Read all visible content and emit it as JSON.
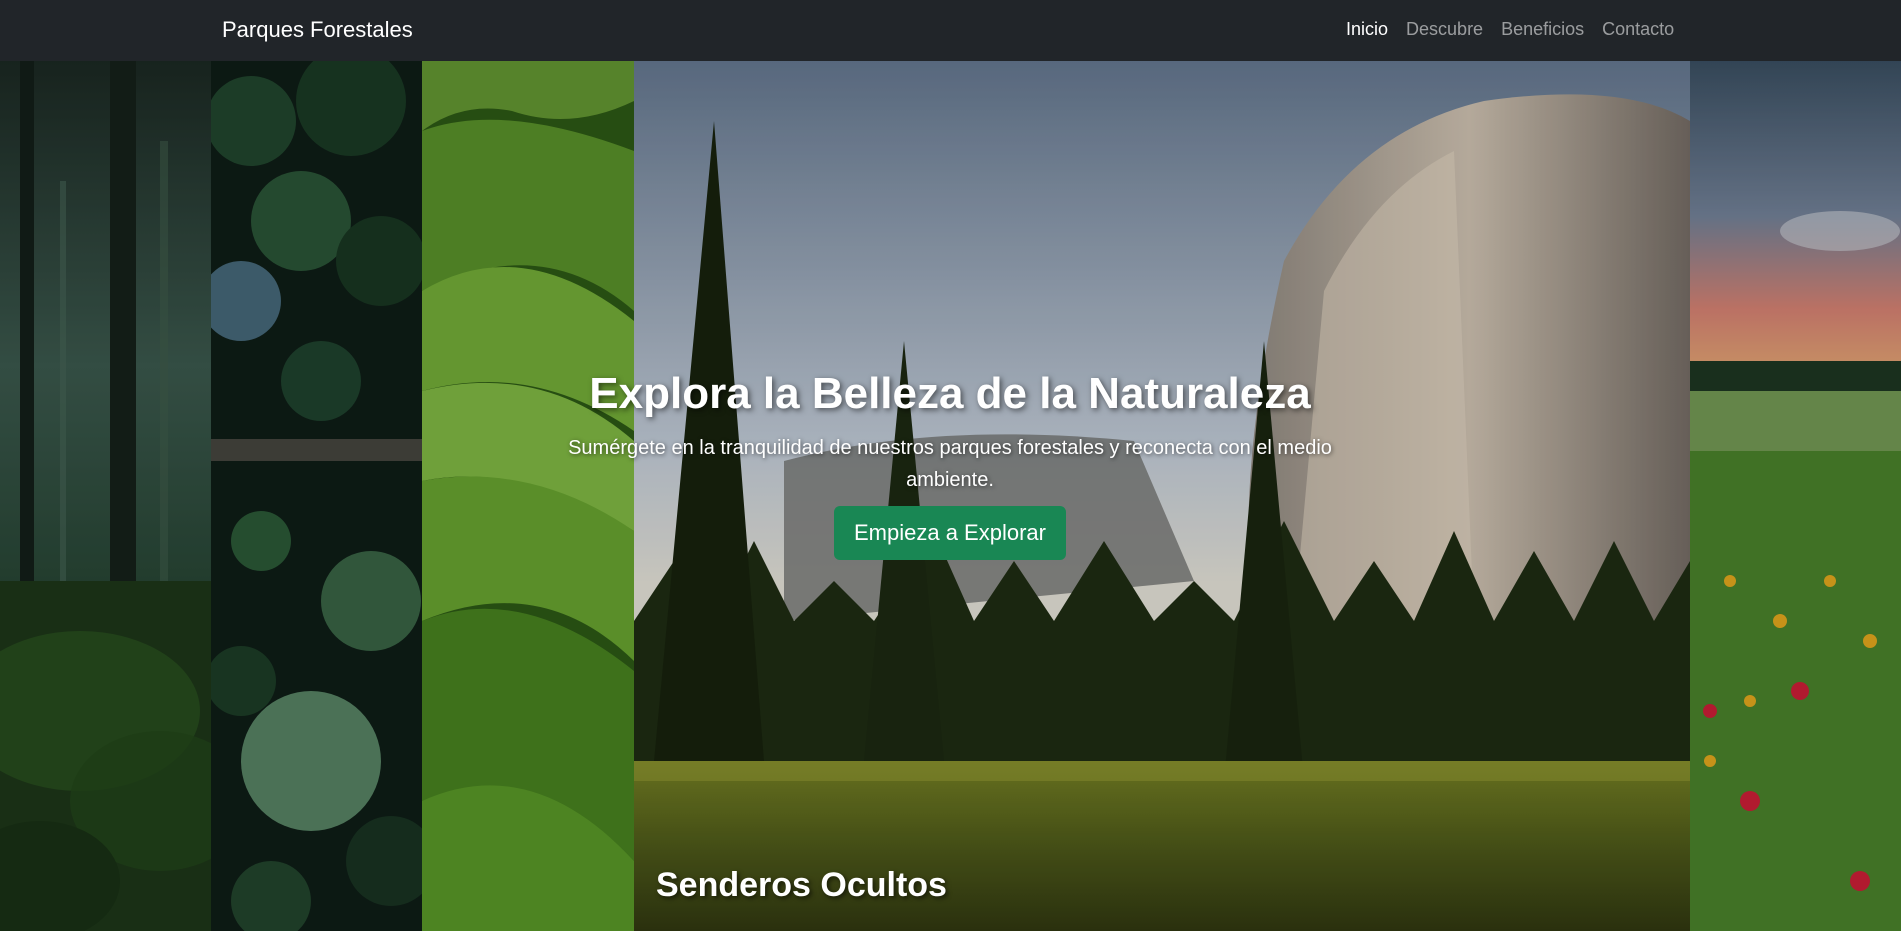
{
  "navbar": {
    "brand": "Parques Forestales",
    "links": [
      {
        "label": "Inicio",
        "active": true
      },
      {
        "label": "Descubre",
        "active": false
      },
      {
        "label": "Beneficios",
        "active": false
      },
      {
        "label": "Contacto",
        "active": false
      }
    ]
  },
  "hero": {
    "title": "Explora la Belleza de la Naturaleza",
    "subtitle": "Sumérgete en la tranquilidad de nuestros parques forestales y reconecta con el medio ambiente.",
    "button_label": "Empieza a Explorar",
    "button_color": "#198754"
  },
  "gallery": {
    "panels": [
      {
        "name": "misty-forest"
      },
      {
        "name": "aerial-forest-road"
      },
      {
        "name": "green-hills"
      },
      {
        "name": "granite-cliff-valley",
        "caption": "Senderos Ocultos"
      },
      {
        "name": "wildflower-meadow"
      }
    ]
  },
  "colors": {
    "navbar_bg": "#212529",
    "nav_active": "#ffffff",
    "nav_inactive": "rgba(255,255,255,0.55)"
  }
}
